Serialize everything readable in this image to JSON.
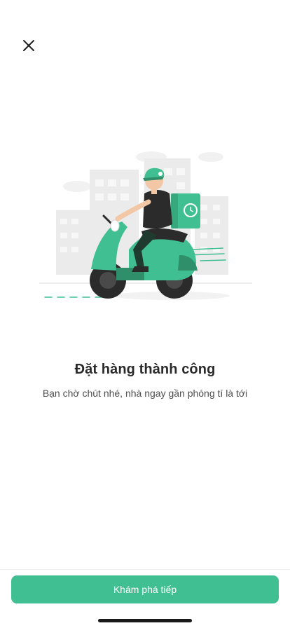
{
  "header": {
    "close_icon": "close-icon"
  },
  "illustration": {
    "name": "delivery-scooter-illustration",
    "colors": {
      "accent": "#40bf93",
      "accent_dark": "#2e8f6a",
      "building": "#e8e8e8",
      "shirt": "#2b2b2b",
      "skin": "#f2c7a5"
    }
  },
  "content": {
    "title": "Đặt hàng thành công",
    "subtitle": "Bạn chờ chút nhé, nhà ngay gần phóng tí là tới"
  },
  "footer": {
    "cta_label": "Khám phá tiếp"
  },
  "theme": {
    "accent": "#40bf93"
  }
}
